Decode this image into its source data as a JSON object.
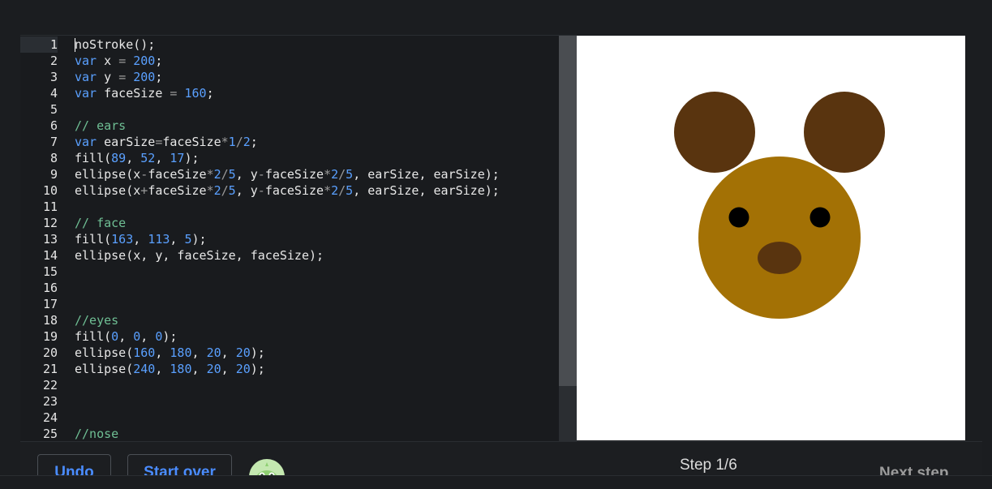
{
  "editor": {
    "lines": [
      {
        "n": "1",
        "tokens": [
          [
            "plain",
            "noStroke();"
          ]
        ]
      },
      {
        "n": "2",
        "tokens": [
          [
            "kw",
            "var"
          ],
          [
            "plain",
            " x "
          ],
          [
            "op",
            "="
          ],
          [
            "plain",
            " "
          ],
          [
            "num",
            "200"
          ],
          [
            "plain",
            ";"
          ]
        ]
      },
      {
        "n": "3",
        "tokens": [
          [
            "kw",
            "var"
          ],
          [
            "plain",
            " y "
          ],
          [
            "op",
            "="
          ],
          [
            "plain",
            " "
          ],
          [
            "num",
            "200"
          ],
          [
            "plain",
            ";"
          ]
        ]
      },
      {
        "n": "4",
        "tokens": [
          [
            "kw",
            "var"
          ],
          [
            "plain",
            " faceSize "
          ],
          [
            "op",
            "="
          ],
          [
            "plain",
            " "
          ],
          [
            "num",
            "160"
          ],
          [
            "plain",
            ";"
          ]
        ]
      },
      {
        "n": "5",
        "tokens": []
      },
      {
        "n": "6",
        "tokens": [
          [
            "cm",
            "// ears"
          ]
        ]
      },
      {
        "n": "7",
        "tokens": [
          [
            "kw",
            "var"
          ],
          [
            "plain",
            " earSize"
          ],
          [
            "op",
            "="
          ],
          [
            "plain",
            "faceSize"
          ],
          [
            "op",
            "*"
          ],
          [
            "num",
            "1"
          ],
          [
            "op",
            "/"
          ],
          [
            "num",
            "2"
          ],
          [
            "plain",
            ";"
          ]
        ]
      },
      {
        "n": "8",
        "tokens": [
          [
            "plain",
            "fill("
          ],
          [
            "num",
            "89"
          ],
          [
            "plain",
            ", "
          ],
          [
            "num",
            "52"
          ],
          [
            "plain",
            ", "
          ],
          [
            "num",
            "17"
          ],
          [
            "plain",
            ");"
          ]
        ]
      },
      {
        "n": "9",
        "tokens": [
          [
            "plain",
            "ellipse(x"
          ],
          [
            "op",
            "-"
          ],
          [
            "plain",
            "faceSize"
          ],
          [
            "op",
            "*"
          ],
          [
            "num",
            "2"
          ],
          [
            "op",
            "/"
          ],
          [
            "num",
            "5"
          ],
          [
            "plain",
            ", y"
          ],
          [
            "op",
            "-"
          ],
          [
            "plain",
            "faceSize"
          ],
          [
            "op",
            "*"
          ],
          [
            "num",
            "2"
          ],
          [
            "op",
            "/"
          ],
          [
            "num",
            "5"
          ],
          [
            "plain",
            ", earSize, earSize);"
          ]
        ]
      },
      {
        "n": "10",
        "tokens": [
          [
            "plain",
            "ellipse(x"
          ],
          [
            "op",
            "+"
          ],
          [
            "plain",
            "faceSize"
          ],
          [
            "op",
            "*"
          ],
          [
            "num",
            "2"
          ],
          [
            "op",
            "/"
          ],
          [
            "num",
            "5"
          ],
          [
            "plain",
            ", y"
          ],
          [
            "op",
            "-"
          ],
          [
            "plain",
            "faceSize"
          ],
          [
            "op",
            "*"
          ],
          [
            "num",
            "2"
          ],
          [
            "op",
            "/"
          ],
          [
            "num",
            "5"
          ],
          [
            "plain",
            ", earSize, earSize);"
          ]
        ]
      },
      {
        "n": "11",
        "tokens": []
      },
      {
        "n": "12",
        "tokens": [
          [
            "cm",
            "// face"
          ]
        ]
      },
      {
        "n": "13",
        "tokens": [
          [
            "plain",
            "fill("
          ],
          [
            "num",
            "163"
          ],
          [
            "plain",
            ", "
          ],
          [
            "num",
            "113"
          ],
          [
            "plain",
            ", "
          ],
          [
            "num",
            "5"
          ],
          [
            "plain",
            ");"
          ]
        ]
      },
      {
        "n": "14",
        "tokens": [
          [
            "plain",
            "ellipse(x, y, faceSize, faceSize);"
          ]
        ]
      },
      {
        "n": "15",
        "tokens": []
      },
      {
        "n": "16",
        "tokens": []
      },
      {
        "n": "17",
        "tokens": []
      },
      {
        "n": "18",
        "tokens": [
          [
            "cm",
            "//eyes"
          ]
        ]
      },
      {
        "n": "19",
        "tokens": [
          [
            "plain",
            "fill("
          ],
          [
            "num",
            "0"
          ],
          [
            "plain",
            ", "
          ],
          [
            "num",
            "0"
          ],
          [
            "plain",
            ", "
          ],
          [
            "num",
            "0"
          ],
          [
            "plain",
            ");"
          ]
        ]
      },
      {
        "n": "20",
        "tokens": [
          [
            "plain",
            "ellipse("
          ],
          [
            "num",
            "160"
          ],
          [
            "plain",
            ", "
          ],
          [
            "num",
            "180"
          ],
          [
            "plain",
            ", "
          ],
          [
            "num",
            "20"
          ],
          [
            "plain",
            ", "
          ],
          [
            "num",
            "20"
          ],
          [
            "plain",
            ");"
          ]
        ]
      },
      {
        "n": "21",
        "tokens": [
          [
            "plain",
            "ellipse("
          ],
          [
            "num",
            "240"
          ],
          [
            "plain",
            ", "
          ],
          [
            "num",
            "180"
          ],
          [
            "plain",
            ", "
          ],
          [
            "num",
            "20"
          ],
          [
            "plain",
            ", "
          ],
          [
            "num",
            "20"
          ],
          [
            "plain",
            ");"
          ]
        ]
      },
      {
        "n": "22",
        "tokens": []
      },
      {
        "n": "23",
        "tokens": []
      },
      {
        "n": "24",
        "tokens": []
      },
      {
        "n": "25",
        "tokens": [
          [
            "cm",
            "//nose"
          ]
        ]
      }
    ],
    "active_line": 1
  },
  "canvas": {
    "background": "#ffffff",
    "ear_color": "#59340f",
    "face_color": "#a37105",
    "eye_color": "#000000",
    "nose_color": "#59340f"
  },
  "toolbar": {
    "undo_label": "Undo",
    "start_over_label": "Start over",
    "step_label": "Step 1/6",
    "next_step_label": "Next step",
    "avatar_icon": "hopper-avatar-icon"
  }
}
